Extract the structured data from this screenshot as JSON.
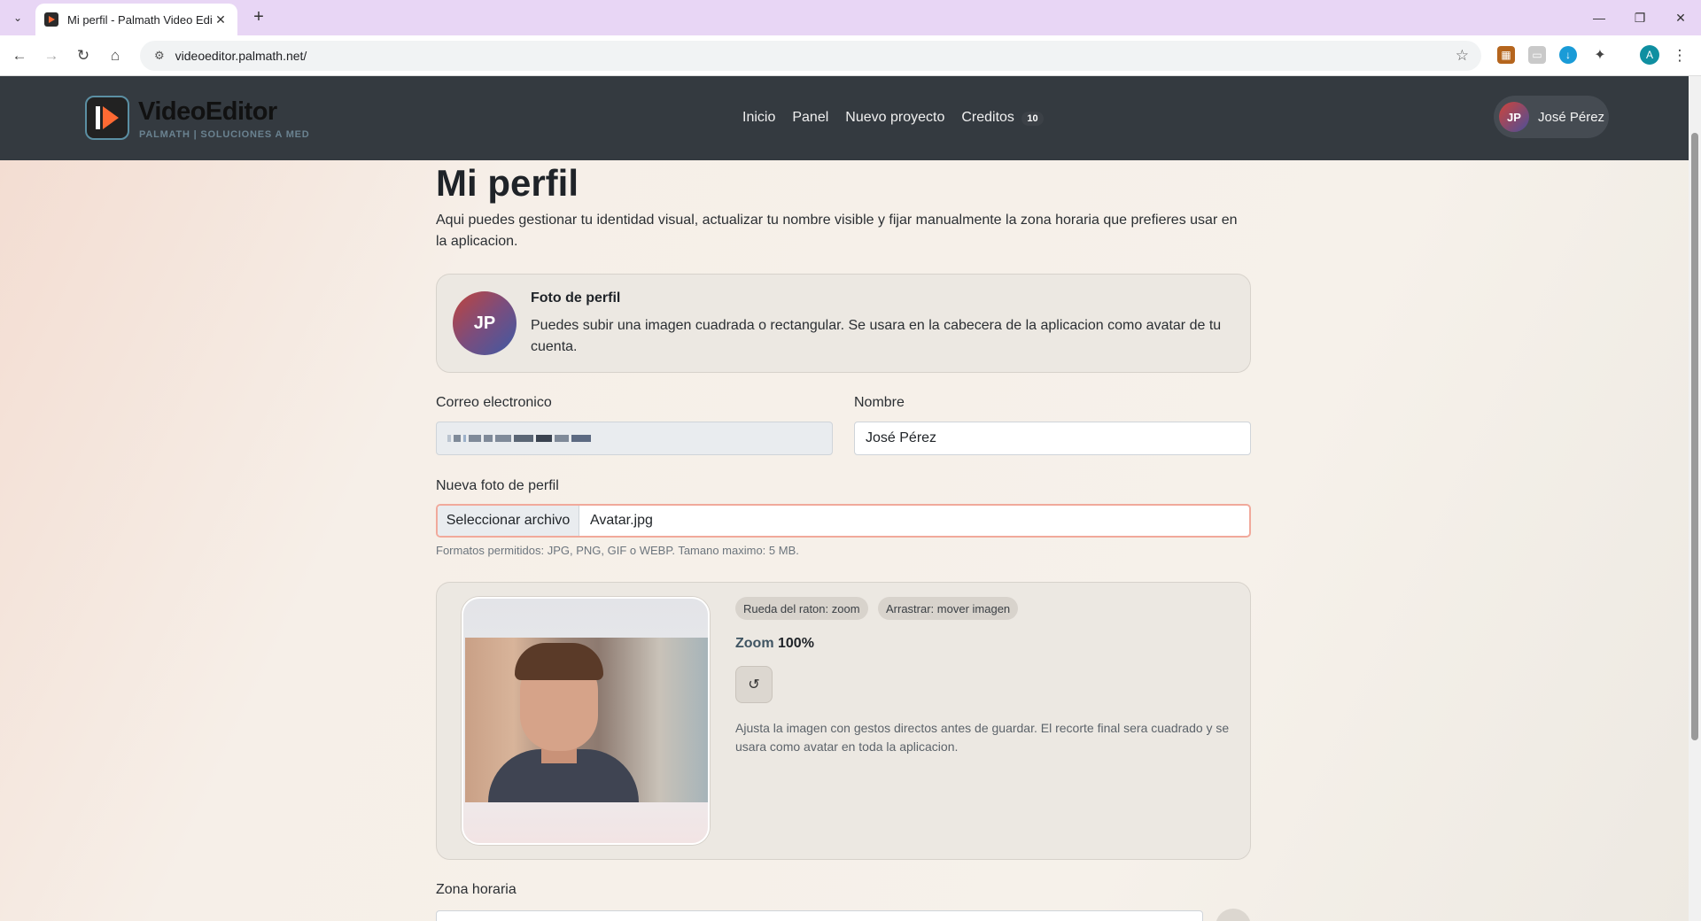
{
  "browser": {
    "tab_title": "Mi perfil - Palmath Video Editor",
    "url": "videoeditor.palmath.net/",
    "profile_initial": "A"
  },
  "app": {
    "brand": "VideoEditor",
    "brand_sub": "PALMATH | SOLUCIONES A MED",
    "nav": {
      "inicio": "Inicio",
      "panel": "Panel",
      "nuevo": "Nuevo proyecto",
      "creditos": "Creditos",
      "creditos_badge": "10"
    },
    "user": {
      "initials": "JP",
      "name": "José Pérez"
    }
  },
  "page": {
    "title": "Mi perfil",
    "intro": "Aqui puedes gestionar tu identidad visual, actualizar tu nombre visible y fijar manualmente la zona horaria que prefieres usar en la aplicacion.",
    "photo_card": {
      "initials": "JP",
      "title": "Foto de perfil",
      "desc": "Puedes subir una imagen cuadrada o rectangular. Se usara en la cabecera de la aplicacion como avatar de tu cuenta."
    },
    "email_label": "Correo electronico",
    "name_label": "Nombre",
    "name_value": "José Pérez",
    "new_photo_label": "Nueva foto de perfil",
    "file_button": "Seleccionar archivo",
    "file_name": "Avatar.jpg",
    "help": "Formatos permitidos: JPG, PNG, GIF o WEBP. Tamano maximo: 5 MB.",
    "crop": {
      "pill_wheel": "Rueda del raton: zoom",
      "pill_drag": "Arrastrar: mover imagen",
      "zoom_label": "Zoom",
      "zoom_value": "100%",
      "reset_icon": "↺",
      "note": "Ajusta la imagen con gestos directos antes de guardar. El recorte final sera cuadrado y se usara como avatar en toda la aplicacion."
    },
    "timezone_label": "Zona horaria"
  }
}
